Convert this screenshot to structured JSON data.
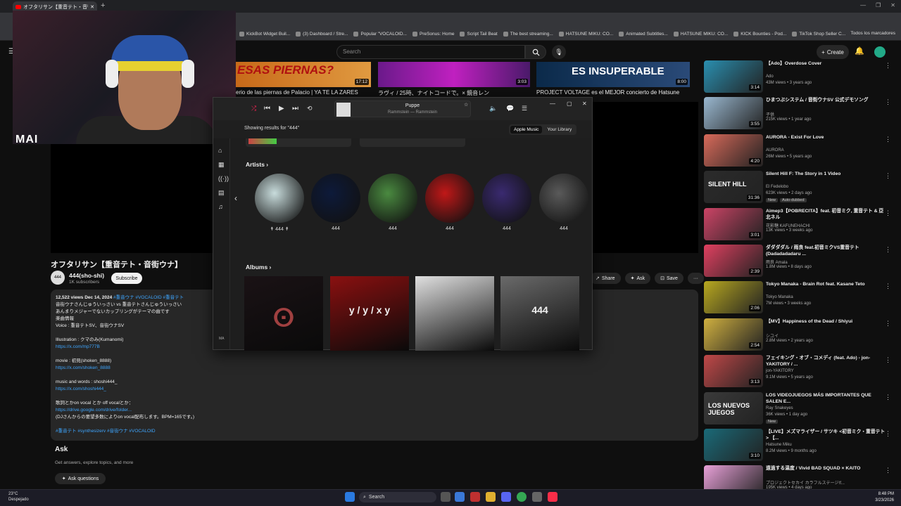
{
  "browser": {
    "tab_title": "オフタリサン【重音テト・音街ウナ】",
    "new_tab": "+",
    "window_controls": [
      "—",
      "❐",
      "✕"
    ],
    "bookmarks": [
      "KickBot Widget Buil...",
      "(3) Dashboard / Stre...",
      "Popular \"VOCALOID...",
      "PreSonus: Home",
      "Script Tail Beat",
      "The best streaming...",
      "HATSUNE MIKU: CO...",
      "Animated Subtitles...",
      "HATSUNE MIKU: CO...",
      "KICK Bounties - Pod...",
      "TikTok Shop Seller C..."
    ],
    "all_bookmarks": "Todos los marcadores"
  },
  "youtube": {
    "search_placeholder": "Search",
    "create_label": "Create"
  },
  "webcam": {
    "overlay_text": "MAI"
  },
  "top_videos": [
    {
      "title": "erio de las piernas de Palacio | YA TE LA ZARES",
      "thumb_text": "ESAS PIERNAS?",
      "duration": "17:12"
    },
    {
      "title": "ラヴィ / 25時、ナイトコードで。× 鏡音レン",
      "thumb_text": "",
      "duration": "3:03"
    },
    {
      "title": "PROJECT VOLTAGE es el MEJOR concierto de Hatsune",
      "thumb_text": "ES INSUPERABLE",
      "duration": "8:00"
    }
  ],
  "video": {
    "title": "オフタリサン【重音テト・音街ウナ】",
    "channel": "444(sho-shi)",
    "subscribers": "1K subscribers",
    "avatar_text": "444",
    "subscribe_label": "Subscribe",
    "share_label": "Share",
    "ask_label": "Ask",
    "save_label": "Save",
    "more_label": "···"
  },
  "description": {
    "meta": "12,522 views  Dec 14, 2024",
    "meta_tags": "#重音ウナ #VOCALOID #重音テト",
    "lines": [
      {
        "text": "音街ウナさんじゅういっさい vs 重音テトさんじゅういっさい",
        "link": false
      },
      {
        "text": "あんまりメジャーでないカップリングがテーマの曲です",
        "link": false
      },
      {
        "text": "楽曲情報",
        "link": false
      },
      {
        "text": "Voice : 重音テトSV、音街ウナSV",
        "link": false
      },
      {
        "text": "",
        "link": false
      },
      {
        "text": "Illustration : クマのみ(Kumanomi)",
        "link": false
      },
      {
        "text": "https://x.com/mp777B",
        "link": true
      },
      {
        "text": "",
        "link": false
      },
      {
        "text": "movie : 初見(shoken_8888)",
        "link": false
      },
      {
        "text": "https://x.com/shoken_8888",
        "link": true
      },
      {
        "text": "",
        "link": false
      },
      {
        "text": "music and words : shoshi444_",
        "link": false
      },
      {
        "text": "https://x.com/shoshi444_",
        "link": true
      },
      {
        "text": "",
        "link": false
      },
      {
        "text": "歌詞とかon vocal とか off vocalとか：",
        "link": false
      },
      {
        "text": "https://drive.google.com/drive/folder...",
        "link": true
      },
      {
        "text": "(DJさんからの要望多数によりon vocal配布します。BPM=165です。)",
        "link": false
      },
      {
        "text": "",
        "link": false
      },
      {
        "text": "#重音テト #synthesizerv #音街ウナ #VOCALOID",
        "link": true
      }
    ]
  },
  "ask": {
    "heading": "Ask",
    "subtitle": "Get answers, explore topics, and more",
    "button": "Ask questions"
  },
  "sidebar": [
    {
      "title": "【Ado】Overdose Cover",
      "channel": "Ado",
      "meta": "43M views • 3 years ago",
      "duration": "3:14",
      "color": "#2a8fb0"
    },
    {
      "title": "ひまつぶシステム / 音街ウナSV 公式デモソング",
      "channel": "子供",
      "meta": "215K views • 1 year ago",
      "duration": "3:55",
      "color": "#9ab8d0"
    },
    {
      "title": "AURORA - Exist For Love",
      "channel": "AURORA",
      "meta": "26M views • 5 years ago",
      "duration": "4:20",
      "color": "#d86a5a"
    },
    {
      "title": "Silent Hill F: The Story in 1 Video",
      "channel": "El Fedelobo",
      "meta": "623K views • 2 days ago",
      "duration": "31:36",
      "badge1": "New",
      "badge2": "Auto-dubbed",
      "color": "#2b2b2b",
      "thumb_text": "SILENT HILL"
    },
    {
      "title": "Aimep3【POBRECITA】feat. 初音ミク, 重音テト & 亞北ネル",
      "channel": "花影糖 KAFUNEHACHI",
      "meta": "13K views • 3 weeks ago",
      "duration": "3:01",
      "color": "#cc4466"
    },
    {
      "title": "ダダダダル / 雨良 feat.初音ミクVS重音テト(Dadadadadaru ...",
      "channel": "雨良 Amala",
      "meta": "1.8M views • 8 days ago",
      "duration": "2:39",
      "color": "#e04060"
    },
    {
      "title": "Tokyo Manaka - Brain Rot feat. Kasane Teto",
      "channel": "Tokyo Manaka",
      "meta": "7M views • 3 weeks ago",
      "duration": "2:06",
      "color": "#b8a820"
    },
    {
      "title": "【MV】Happiness of the Dead / Shiyui",
      "channel": "シユイ",
      "meta": "2.8M views • 2 years ago",
      "duration": "2:54",
      "color": "#d0b040"
    },
    {
      "title": "フェイキング・オブ・コメディ (feat. Ado) - jon-YAKITORY / ...",
      "channel": "jon-YAKITORY",
      "meta": "9.1M views • 5 years ago",
      "duration": "3:13",
      "color": "#c04848"
    },
    {
      "title": "LOS VIDEOJUEGOS MÁS IMPORTANTES QUE SALEN E...",
      "channel": "Ray Snakeyes",
      "meta": "36K views • 1 day ago",
      "duration": "",
      "badge1": "New",
      "color": "#3a3a3a",
      "thumb_text": "LOS NUEVOS JUEGOS"
    },
    {
      "title": "【LIVE】メズマライザー / サツキ <初音ミク・重音テト> 【...",
      "channel": "Hatsune Miku",
      "meta": "8.2M views • 9 months ago",
      "duration": "3:10",
      "color": "#1a6a78"
    },
    {
      "title": "遠過する温度 / Vivid BAD SQUAD × KAITO",
      "channel": "プロジェクトセカイ カラフルステージ!f...",
      "meta": "195K views • 4 days ago",
      "duration": "",
      "color": "#e8a0d8"
    }
  ],
  "music": {
    "window_controls": [
      "—",
      "▢",
      "✕"
    ],
    "now_playing_title": "Puppe",
    "now_playing_sub": "Rammstein — Rammstein",
    "showing": "Showing results for \"444\"",
    "segments": [
      "Apple Music",
      "Your Library"
    ],
    "artists_heading": "Artists",
    "albums_heading": "Albums",
    "artists": [
      {
        "name": "↟ 444 ↟",
        "color": "#c8dcdc"
      },
      {
        "name": "444",
        "color": "#0d1a3a"
      },
      {
        "name": "444",
        "color": "#4a8a40"
      },
      {
        "name": "444",
        "color": "#c01818"
      },
      {
        "name": "444",
        "color": "#3a2a70"
      },
      {
        "name": "444",
        "color": "#5a5a5a"
      }
    ],
    "albums": [
      {
        "art": "#1a1215",
        "text": "ⵙ"
      },
      {
        "art": "#8a1010",
        "text": "y / y / x y"
      },
      {
        "art": "#e0e0e0",
        "text": ""
      },
      {
        "art": "#6a6a6a",
        "text": "444"
      }
    ],
    "sidebar_badge": "MA"
  },
  "taskbar": {
    "temperature": "23°C",
    "weather": "Despejado",
    "search": "Search",
    "time": "8:48 PM",
    "date": "3/23/2026"
  }
}
